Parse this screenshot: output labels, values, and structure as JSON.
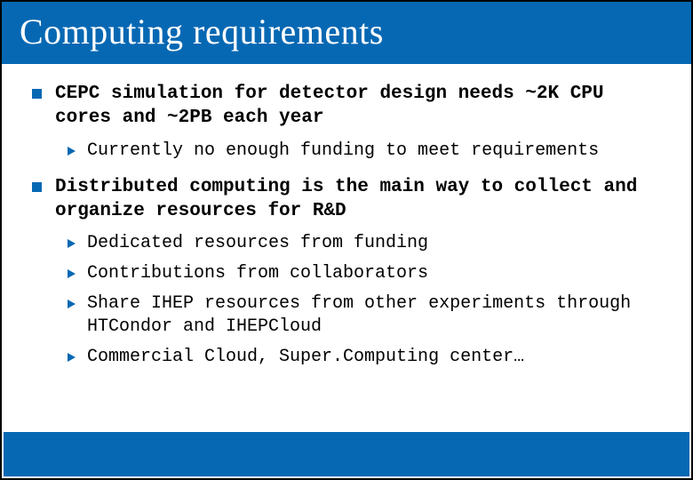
{
  "title": "Computing requirements",
  "bullets": [
    {
      "text": "CEPC simulation for detector design needs ~2K CPU cores and ~2PB each year",
      "subs": [
        "Currently no enough funding to meet requirements"
      ]
    },
    {
      "text": "Distributed computing is the main way to collect and organize resources for R&D",
      "subs": [
        "Dedicated resources from funding",
        "Contributions from collaborators",
        "Share IHEP resources from other experiments through HTCondor and IHEPCloud",
        "Commercial Cloud, Super.Computing center…"
      ]
    }
  ]
}
